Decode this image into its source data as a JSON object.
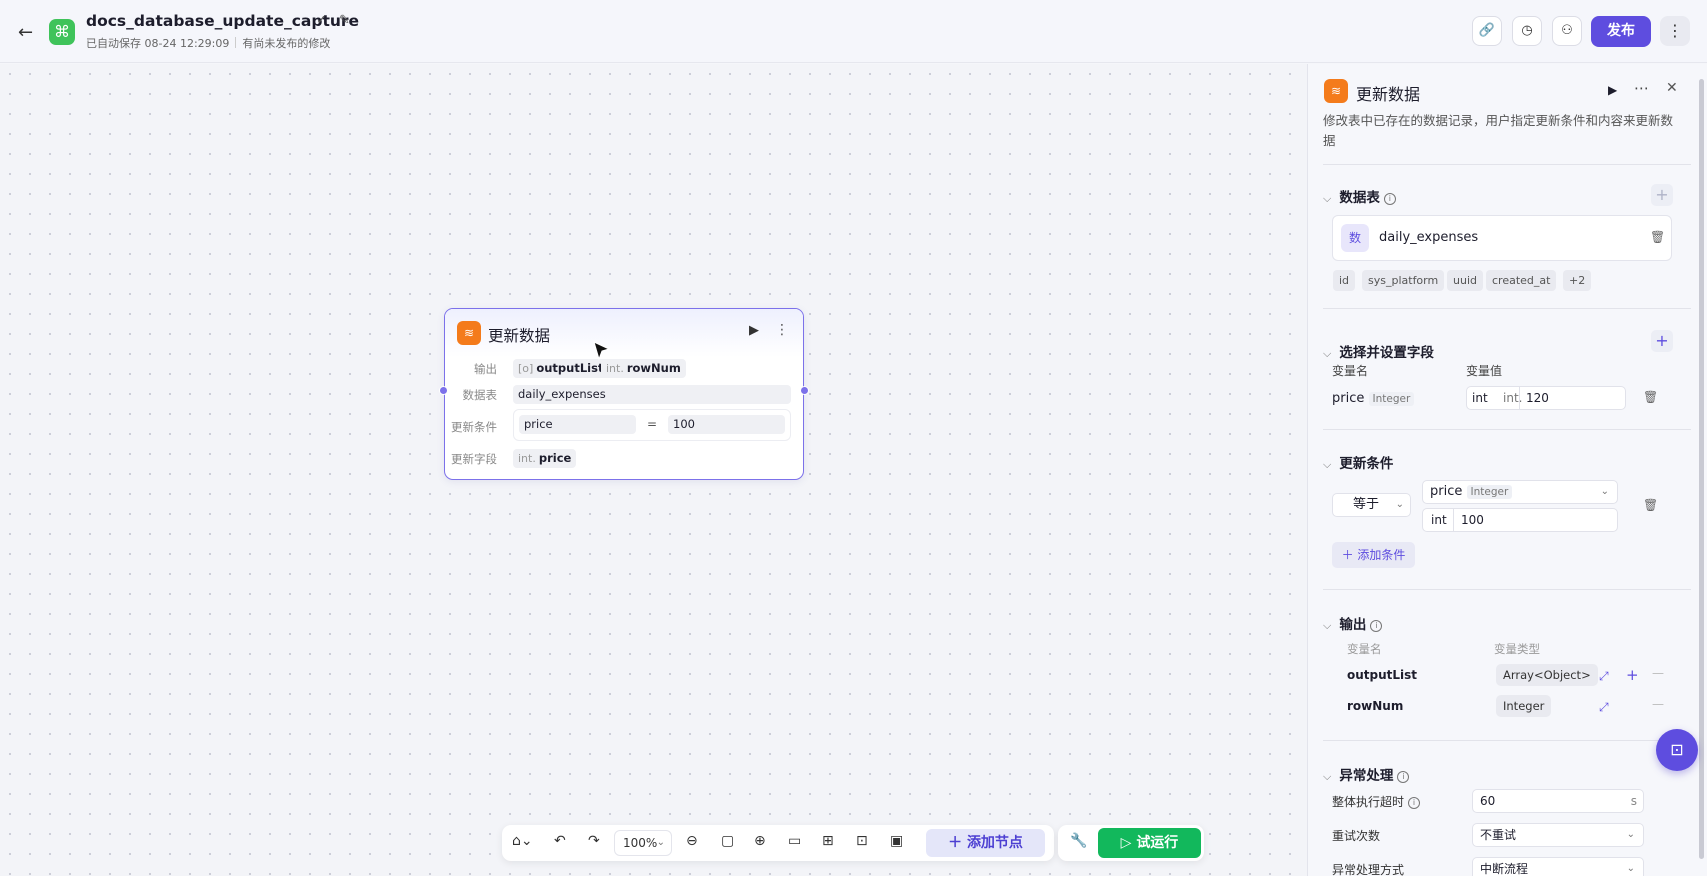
{
  "header": {
    "app_name": "docs_database_update_capture",
    "autosave": "已自动保存 08-24 12:29:09",
    "unpublished": "有尚未发布的修改",
    "publish_label": "发布"
  },
  "node": {
    "title": "更新数据",
    "output_label": "输出",
    "outputs": [
      {
        "type": "[o]",
        "name": "outputList"
      },
      {
        "type": "int.",
        "name": "rowNum"
      }
    ],
    "table_label": "数据表",
    "table_value": "daily_expenses",
    "condition_label": "更新条件",
    "cond_field": "price",
    "cond_op": "=",
    "cond_value": "100",
    "fields_label": "更新字段",
    "field_type": "int.",
    "field_name": "price"
  },
  "toolbar": {
    "zoom": "100%",
    "add_node": "添加节点",
    "test_run": "试运行"
  },
  "panel": {
    "title": "更新数据",
    "description": "修改表中已存在的数据记录，用户指定更新条件和内容来更新数据",
    "table_section": {
      "title": "数据表",
      "table_icon_text": "数",
      "table_name": "daily_expenses",
      "columns": [
        "id",
        "sys_platform",
        "uuid",
        "created_at",
        "+2"
      ]
    },
    "fields_section": {
      "title": "选择并设置字段",
      "col_var_name": "变量名",
      "col_var_value": "变量值",
      "row": {
        "name": "price",
        "type": "Integer",
        "value_type": "int",
        "prefix": "int.",
        "value": "120"
      }
    },
    "condition_section": {
      "title": "更新条件",
      "logic": "等于",
      "field": "price",
      "field_type": "Integer",
      "value_type": "int",
      "value": "100",
      "add_label": "添加条件"
    },
    "output_section": {
      "title": "输出",
      "col_var_name": "变量名",
      "col_var_type": "变量类型",
      "rows": [
        {
          "name": "outputList",
          "type": "Array<Object>"
        },
        {
          "name": "rowNum",
          "type": "Integer"
        }
      ]
    },
    "exception_section": {
      "title": "异常处理",
      "timeout_label": "整体执行超时",
      "timeout_value": "60",
      "timeout_unit": "s",
      "retry_label": "重试次数",
      "retry_value": "不重试",
      "mode_label": "异常处理方式",
      "mode_value": "中断流程"
    }
  }
}
